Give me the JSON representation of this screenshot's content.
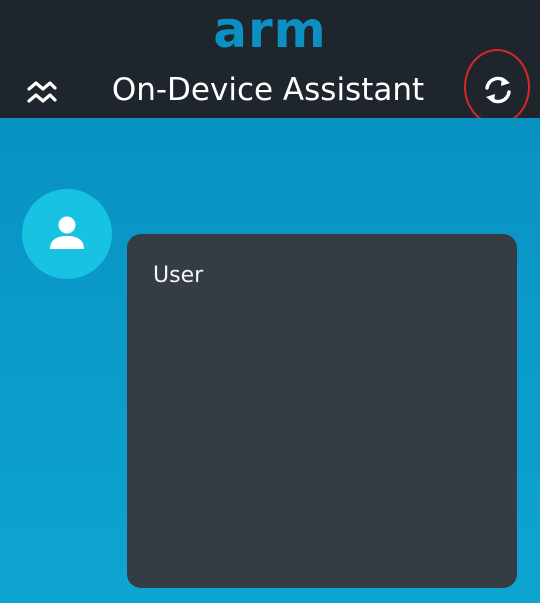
{
  "header": {
    "brand": "arm",
    "title": "On-Device Assistant",
    "menu_icon": "zigzag-menu-icon",
    "refresh_icon": "refresh-icon"
  },
  "conversation": {
    "messages": [
      {
        "role_icon": "user-avatar-icon",
        "text": "User"
      }
    ]
  },
  "colors": {
    "header_bg": "#1f252c",
    "brand": "#0c8fc3",
    "content_bg": "#0a96c4",
    "avatar_bg": "#18c2e2",
    "bubble_bg": "#353c44",
    "highlight": "#d62828"
  }
}
